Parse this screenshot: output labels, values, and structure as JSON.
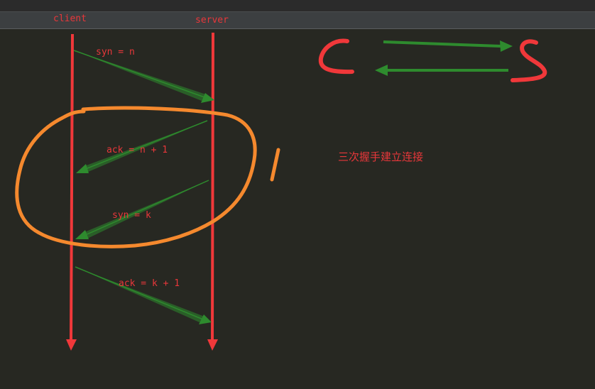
{
  "header": {
    "client_label": "client",
    "server_label": "server"
  },
  "messages": [
    {
      "label": "syn = n",
      "from": "client",
      "to": "server"
    },
    {
      "label": "ack = n + 1",
      "from": "server",
      "to": "client"
    },
    {
      "label": "syn = k",
      "from": "server",
      "to": "client"
    },
    {
      "label": "ack = k + 1",
      "from": "client",
      "to": "server"
    }
  ],
  "sketch": {
    "left_letter": "C",
    "right_letter": "S"
  },
  "annotation": "三次握手建立连接",
  "colors": {
    "background": "#272822",
    "lifeline": "#f0383a",
    "message_arrow": "#2e8b2e",
    "label_text": "#e8373a",
    "highlight_ellipse": "#f5892e"
  }
}
